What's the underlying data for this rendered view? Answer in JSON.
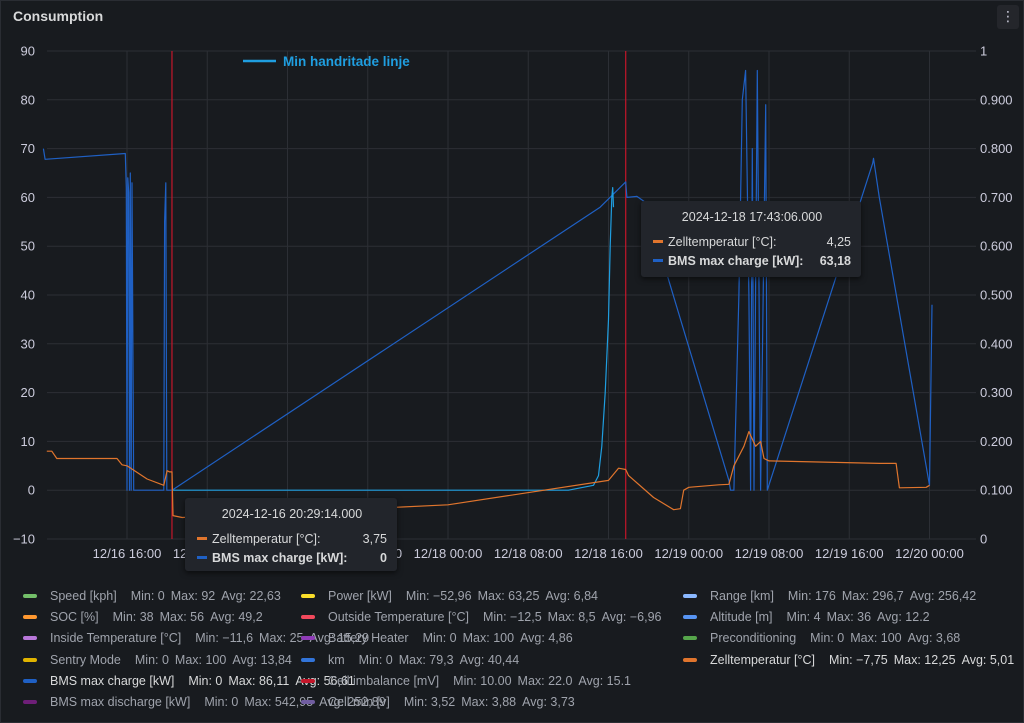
{
  "panel": {
    "title": "Consumption",
    "menu_icon": "kebab-vertical-icon"
  },
  "annotation": {
    "label": "Min handritade linje",
    "color": "#1f9ee0"
  },
  "chart_data": {
    "type": "line",
    "x_ticks": [
      "12/16 16:00",
      "12/17 00:00",
      "12/17 08:00",
      "12/17 16:00",
      "12/18 00:00",
      "12/18 08:00",
      "12/18 16:00",
      "12/19 00:00",
      "12/19 08:00",
      "12/19 16:00",
      "12/20 00:00"
    ],
    "y_left_ticks": [
      "90",
      "80",
      "70",
      "60",
      "50",
      "40",
      "30",
      "20",
      "10",
      "0",
      "−10"
    ],
    "y_left_range": [
      -10,
      90
    ],
    "y_right_ticks": [
      "1",
      "0.900",
      "0.800",
      "0.700",
      "0.600",
      "0.500",
      "0.400",
      "0.300",
      "0.200",
      "0.100",
      "0"
    ],
    "y_right_range": [
      0,
      1
    ],
    "grid": true,
    "x_start": "2024-12-16 08:00",
    "series": [
      {
        "name": "BMS max charge [kW]",
        "color": "#1f60c4",
        "points": [
          [
            "2024-12-16 07:40",
            70
          ],
          [
            "2024-12-16 07:50",
            67.8
          ],
          [
            "2024-12-16 15:50",
            69
          ],
          [
            "2024-12-16 15:56",
            62
          ],
          [
            "2024-12-16 16:00",
            0
          ],
          [
            "2024-12-16 16:05",
            64
          ],
          [
            "2024-12-16 16:10",
            61
          ],
          [
            "2024-12-16 16:15",
            0
          ],
          [
            "2024-12-16 16:20",
            65
          ],
          [
            "2024-12-16 16:25",
            0
          ],
          [
            "2024-12-16 16:30",
            63
          ],
          [
            "2024-12-16 16:40",
            0
          ],
          [
            "2024-12-16 19:40",
            0
          ],
          [
            "2024-12-16 19:45",
            55
          ],
          [
            "2024-12-16 19:52",
            63
          ],
          [
            "2024-12-16 19:58",
            0
          ],
          [
            "2024-12-16 20:29",
            0
          ],
          [
            "2024-12-18 15:10",
            58
          ],
          [
            "2024-12-18 17:43",
            63.18
          ],
          [
            "2024-12-18 17:50",
            60
          ],
          [
            "2024-12-18 18:50",
            60.2
          ],
          [
            "2024-12-18 19:40",
            59
          ],
          [
            "2024-12-19 04:00",
            2
          ],
          [
            "2024-12-19 04:10",
            0
          ],
          [
            "2024-12-19 04:30",
            0
          ],
          [
            "2024-12-19 05:00",
            40
          ],
          [
            "2024-12-19 05:20",
            80
          ],
          [
            "2024-12-19 05:40",
            86
          ],
          [
            "2024-12-19 06:00",
            40
          ],
          [
            "2024-12-19 06:10",
            0
          ],
          [
            "2024-12-19 06:20",
            70
          ],
          [
            "2024-12-19 06:30",
            0
          ],
          [
            "2024-12-19 06:50",
            86
          ],
          [
            "2024-12-19 07:10",
            0
          ],
          [
            "2024-12-19 07:40",
            79
          ],
          [
            "2024-12-19 07:50",
            0
          ],
          [
            "2024-12-19 18:20",
            67
          ],
          [
            "2024-12-19 18:25",
            68
          ],
          [
            "2024-12-19 19:00",
            60
          ],
          [
            "2024-12-20 00:00",
            1
          ],
          [
            "2024-12-20 00:15",
            38
          ]
        ]
      },
      {
        "name": "Min handritade linje",
        "color": "#1f9ee0",
        "points": [
          [
            "2024-12-16 20:29",
            0
          ],
          [
            "2024-12-18 12:00",
            0
          ],
          [
            "2024-12-18 14:30",
            1
          ],
          [
            "2024-12-18 15:00",
            3
          ],
          [
            "2024-12-18 15:20",
            9
          ],
          [
            "2024-12-18 15:40",
            20
          ],
          [
            "2024-12-18 16:00",
            35
          ],
          [
            "2024-12-18 16:10",
            50
          ],
          [
            "2024-12-18 16:20",
            60
          ],
          [
            "2024-12-18 16:25",
            62
          ],
          [
            "2024-12-18 16:30",
            58
          ]
        ]
      },
      {
        "name": "Zelltemperatur [°C]",
        "color": "#e0752d",
        "points": [
          [
            "2024-12-16 08:00",
            8
          ],
          [
            "2024-12-16 08:30",
            8
          ],
          [
            "2024-12-16 09:00",
            6.5
          ],
          [
            "2024-12-16 15:00",
            6.5
          ],
          [
            "2024-12-16 15:30",
            5.2
          ],
          [
            "2024-12-16 16:00",
            5
          ],
          [
            "2024-12-16 18:00",
            2.3
          ],
          [
            "2024-12-16 19:40",
            1
          ],
          [
            "2024-12-16 20:00",
            4
          ],
          [
            "2024-12-16 20:15",
            3.75
          ],
          [
            "2024-12-16 20:29",
            3.75
          ],
          [
            "2024-12-16 20:35",
            -5.2
          ],
          [
            "2024-12-16 21:30",
            -5.6
          ],
          [
            "2024-12-18 00:00",
            -3
          ],
          [
            "2024-12-18 16:00",
            2
          ],
          [
            "2024-12-18 17:00",
            4.5
          ],
          [
            "2024-12-18 17:43",
            4.25
          ],
          [
            "2024-12-18 18:00",
            3
          ],
          [
            "2024-12-18 20:30",
            -1.5
          ],
          [
            "2024-12-18 22:30",
            -4
          ],
          [
            "2024-12-18 23:10",
            -3.8
          ],
          [
            "2024-12-18 23:30",
            0
          ],
          [
            "2024-12-19 00:00",
            0.6
          ],
          [
            "2024-12-19 03:00",
            1.1
          ],
          [
            "2024-12-19 04:00",
            1.2
          ],
          [
            "2024-12-19 04:30",
            5
          ],
          [
            "2024-12-19 05:30",
            9
          ],
          [
            "2024-12-19 06:00",
            12
          ],
          [
            "2024-12-19 06:40",
            9
          ],
          [
            "2024-12-19 07:10",
            10
          ],
          [
            "2024-12-19 07:30",
            6.5
          ],
          [
            "2024-12-19 08:00",
            6
          ],
          [
            "2024-12-19 19:00",
            5.5
          ],
          [
            "2024-12-19 20:40",
            5.5
          ],
          [
            "2024-12-19 21:00",
            0.5
          ],
          [
            "2024-12-19 23:40",
            0.6
          ],
          [
            "2024-12-20 00:00",
            1
          ]
        ]
      }
    ],
    "markers": [
      {
        "name": "Cell imbalance [mV]",
        "color": "#c4162a",
        "x": "2024-12-16 20:29"
      },
      {
        "name": "Cell imbalance [mV]",
        "color": "#c4162a",
        "x": "2024-12-18 17:43"
      }
    ]
  },
  "tooltips": [
    {
      "time": "2024-12-18 17:43:06.000",
      "rows": [
        {
          "label": "Zelltemperatur [°C]:",
          "value": "4,25",
          "color": "#e0752d",
          "bold": false
        },
        {
          "label": "BMS max charge [kW]:",
          "value": "63,18",
          "color": "#1f60c4",
          "bold": true
        }
      ]
    },
    {
      "time": "2024-12-16 20:29:14.000",
      "rows": [
        {
          "label": "Zelltemperatur [°C]:",
          "value": "3,75",
          "color": "#e0752d",
          "bold": false
        },
        {
          "label": "BMS max charge [kW]:",
          "value": "0",
          "color": "#1f60c4",
          "bold": true
        }
      ]
    }
  ],
  "legend": [
    [
      {
        "name": "Speed [kph]",
        "color": "#73bf69",
        "min": "Min: 0",
        "max": "Max: 92",
        "avg": "Avg: 22,63"
      },
      {
        "name": "Power [kW]",
        "color": "#fade2a",
        "min": "Min: −52,96",
        "max": "Max: 63,25",
        "avg": "Avg: 6,84"
      },
      {
        "name": "Range [km]",
        "color": "#8ab8ff",
        "min": "Min: 176",
        "max": "Max: 296,7",
        "avg": "Avg: 256,42"
      }
    ],
    [
      {
        "name": "SOC [%]",
        "color": "#ff9830",
        "min": "Min: 38",
        "max": "Max: 56",
        "avg": "Avg: 49,2"
      },
      {
        "name": "Outside Temperature [°C]",
        "color": "#f2495c",
        "min": "Min: −12,5",
        "max": "Max: 8,5",
        "avg": "Avg: −6,96"
      },
      {
        "name": "Altitude [m]",
        "color": "#5794f2",
        "min": "Min: 4",
        "max": "Max: 36",
        "avg": "Avg: 12.2"
      }
    ],
    [
      {
        "name": "Inside Temperature [°C]",
        "color": "#b877d9",
        "min": "Min: −11,6",
        "max": "Max: 25",
        "avg": "Avg: 15,29"
      },
      {
        "name": "Battery Heater",
        "color": "#8f3bb8",
        "min": "Min: 0",
        "max": "Max: 100",
        "avg": "Avg: 4,86"
      },
      {
        "name": "Preconditioning",
        "color": "#56a64b",
        "min": "Min: 0",
        "max": "Max: 100",
        "avg": "Avg: 3,68"
      }
    ],
    [
      {
        "name": "Sentry Mode",
        "color": "#e0b400",
        "min": "Min: 0",
        "max": "Max: 100",
        "avg": "Avg: 13,84"
      },
      {
        "name": "km",
        "color": "#3274d9",
        "min": "Min: 0",
        "max": "Max: 79,3",
        "avg": "Avg: 40,44"
      },
      {
        "name": "Zelltemperatur [°C]",
        "color": "#e0752d",
        "min": "Min: −7,75",
        "max": "Max: 12,25",
        "avg": "Avg: 5,01",
        "active": true
      }
    ],
    [
      {
        "name": "BMS max charge [kW]",
        "color": "#1f60c4",
        "min": "Min: 0",
        "max": "Max: 86,11",
        "avg": "Avg: 56,61",
        "active": true
      },
      {
        "name": "Cell imbalance [mV]",
        "color": "#c4162a",
        "min": "Min: 10.00",
        "max": "Max: 22.0",
        "avg": "Avg: 15.1"
      }
    ],
    [
      {
        "name": "BMS max discharge [kW]",
        "color": "#6e1f78",
        "min": "Min: 0",
        "max": "Max: 542,95",
        "avg": "Avg: 252,89"
      },
      {
        "name": "Cell min [v]",
        "color": "#705da0",
        "min": "Min: 3,52",
        "max": "Max: 3,88",
        "avg": "Avg: 3,73"
      }
    ]
  ]
}
